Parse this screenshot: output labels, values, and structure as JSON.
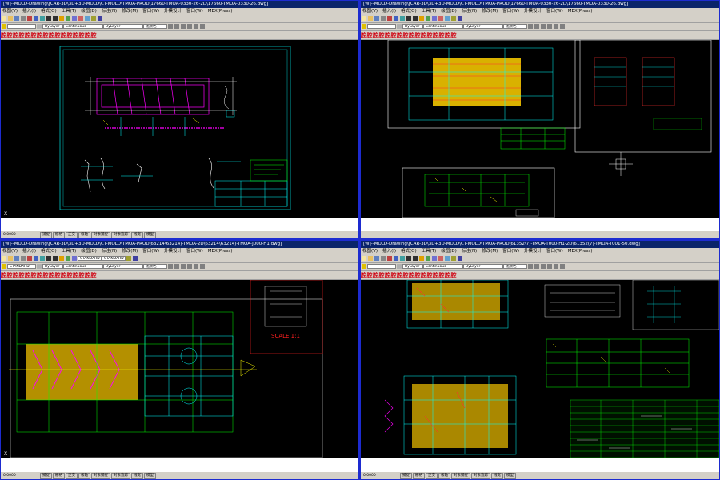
{
  "menu": [
    "视图(V)",
    "插入(I)",
    "格式(O)",
    "工具(T)",
    "绘图(D)",
    "标注(N)",
    "修改(M)",
    "窗口(W)",
    "外模设计",
    "窗口(W)",
    "MEX(Press)"
  ],
  "cad_buttons": [
    "腔",
    "腔",
    "腔",
    "腔",
    "腔",
    "腔",
    "腔",
    "腔",
    "腔",
    "腔",
    "腔",
    "腔",
    "腔",
    "腔",
    "腔",
    "腔"
  ],
  "colors": {
    "bg_blue": "#1d2bd0",
    "titlebar": "#0a246a",
    "chrome": "#d4d0c8",
    "canvas": "#000000"
  },
  "windows": [
    {
      "title": "[W]--MOLD-Drawing\\[CAR-3D\\3D+3D-MOLD\\CT-MOLD\\TMOA-PROD\\17660-TMOA-0330-26-2D\\17660-TMOA-0330-26.dwg]",
      "layer": "",
      "combo_linetype": "Continuous",
      "combo_color": "ByLayer",
      "combo_plot": "随颜色",
      "coord": "0.0000",
      "status": [
        "捕捉",
        "栅格",
        "正交",
        "极轴",
        "对象捕捉",
        "对象追踪",
        "线宽",
        "模型"
      ],
      "annotations": []
    },
    {
      "title": "[W]--MOLD-Drawing\\[CAR-3D\\3D+3D-MOLD\\CT-MOLD\\TMOA-PROD\\17660-TMOA-0330-26-2D\\17660-TMOA-0330-26.dwg]",
      "layer": "",
      "combo_linetype": "Continuous",
      "combo_color": "ByLayer",
      "combo_plot": "随颜色",
      "coord": "",
      "status": [
        "捕捉",
        "栅格",
        "正交",
        "极轴",
        "对象捕捉",
        "对象追踪",
        "线宽",
        "模型"
      ],
      "annotations": []
    },
    {
      "title": "[W]--MOLD-Drawing\\[CAR-3D\\3D+3D-MOLD\\CT-MOLD\\TMOA-PROD\\63214\\63214)-TMOA-2D\\63214\\63214)-TMOA-J000-H1.dwg]",
      "layer": "STANDARD",
      "combo_linetype": "Continuous",
      "combo_color": "ByLayer",
      "combo_plot": "随颜色",
      "coord": "0.0000",
      "status": [
        "捕捉",
        "栅格",
        "正交",
        "极轴",
        "对象捕捉",
        "对象追踪",
        "线宽",
        "模型"
      ],
      "annotations": [
        "SCALE 1:1"
      ]
    },
    {
      "title": "[W]--MOLD-Drawing\\[CAR-3D\\3D+3D-MOLD\\CT-MOLD\\TMOA-PROD\\61352\\7)-TMOA-T000-H1-2D\\61352(7)-TMOA-T001-50.dwg]",
      "layer": "",
      "combo_linetype": "Continuous",
      "combo_color": "ByLayer",
      "combo_plot": "随颜色",
      "coord": "0.0000",
      "status": [
        "捕捉",
        "栅格",
        "正交",
        "极轴",
        "对象捕捉",
        "对象追踪",
        "线宽",
        "模型"
      ],
      "annotations": []
    }
  ]
}
